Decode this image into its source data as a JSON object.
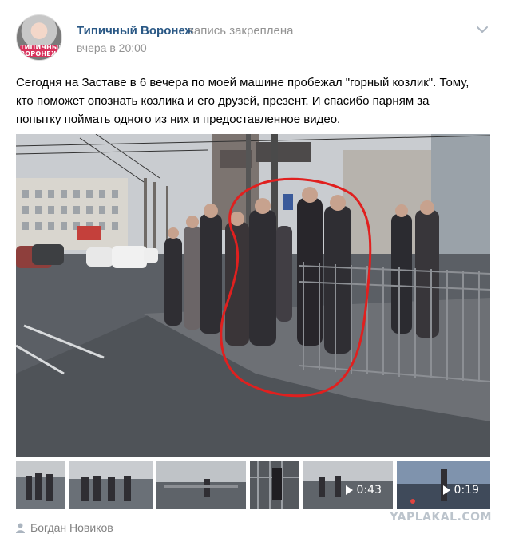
{
  "post": {
    "group_name": "Типичный Воронеж",
    "pinned_label": "запись закреплена",
    "time": "вчера в 20:00",
    "avatar_text": "ТИПИЧНЫЙ ВОРОНЕЖ",
    "text_lines": [
      "Сегодня на Заставе в 6 вечера по моей машине пробежал \"горный козлик\". Тому,",
      "кто поможет опознать козлика и его друзей, презент. И спасибо парням за",
      "попытку поймать одного из них и предоставленное видео."
    ],
    "author": "Богдан Новиков"
  },
  "attachments": {
    "main_video": {
      "type": "video",
      "description_icon": "video-frame"
    },
    "thumbs": [
      {
        "type": "photo"
      },
      {
        "type": "photo"
      },
      {
        "type": "photo"
      },
      {
        "type": "photo"
      },
      {
        "type": "video",
        "duration": "0:43"
      },
      {
        "type": "video",
        "duration": "0:19"
      }
    ]
  },
  "watermark": "YAPLAKAL.COM",
  "colors": {
    "link": "#2a5885",
    "meta": "#939393",
    "annotation_red": "#e0201f"
  }
}
